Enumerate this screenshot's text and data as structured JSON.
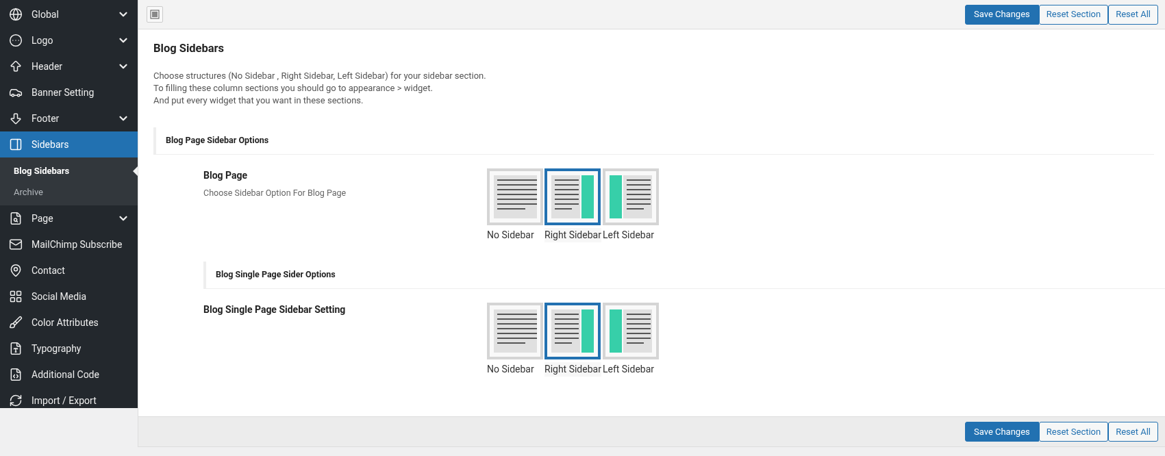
{
  "sidebar": {
    "items": [
      {
        "label": "Global",
        "expandable": true,
        "selected": false
      },
      {
        "label": "Logo",
        "expandable": true,
        "selected": false
      },
      {
        "label": "Header",
        "expandable": true,
        "selected": false
      },
      {
        "label": "Banner Setting",
        "expandable": false,
        "selected": false
      },
      {
        "label": "Footer",
        "expandable": true,
        "selected": false
      },
      {
        "label": "Sidebars",
        "expandable": false,
        "selected": true,
        "children": [
          {
            "label": "Blog Sidebars",
            "selected": true
          },
          {
            "label": "Archive",
            "selected": false
          }
        ]
      },
      {
        "label": "Page",
        "expandable": true,
        "selected": false
      },
      {
        "label": "MailChimp Subscribe",
        "expandable": false,
        "selected": false
      },
      {
        "label": "Contact",
        "expandable": false,
        "selected": false
      },
      {
        "label": "Social Media",
        "expandable": false,
        "selected": false
      },
      {
        "label": "Color Attributes",
        "expandable": false,
        "selected": false
      },
      {
        "label": "Typography",
        "expandable": false,
        "selected": false
      },
      {
        "label": "Additional Code",
        "expandable": false,
        "selected": false
      },
      {
        "label": "Import / Export",
        "expandable": false,
        "selected": false
      }
    ]
  },
  "toolbar_buttons": [
    "Save Changes",
    "Reset Section",
    "Reset All"
  ],
  "section": {
    "title": "Blog Sidebars",
    "description": [
      "Choose structures (No Sidebar , Right Sidebar, Left Sidebar) for your sidebar section.",
      "To filling these column sections you should go to appearance > widget.",
      "And put every widget that you want in these sections."
    ]
  },
  "groups": [
    {
      "heading": "Blog Page Sidebar Options",
      "indented": false,
      "field": {
        "label": "Blog Page",
        "hint": "Choose Sidebar Option For Blog Page",
        "options": [
          {
            "kind": "none",
            "label": "No Sidebar",
            "selected": false
          },
          {
            "kind": "right",
            "label": "Right Sidebar",
            "selected": true
          },
          {
            "kind": "left",
            "label": "Left Sidebar",
            "selected": false
          }
        ]
      }
    },
    {
      "heading": "Blog Single Page Sider Options",
      "indented": true,
      "field": {
        "label": "Blog Single Page Sidebar Setting",
        "options": [
          {
            "kind": "none",
            "label": "No Sidebar",
            "selected": false
          },
          {
            "kind": "right",
            "label": "Right Sidebar",
            "selected": true
          },
          {
            "kind": "left",
            "label": "Left Sidebar",
            "selected": false
          }
        ]
      }
    }
  ],
  "footer_buttons": [
    "Save Changes",
    "Reset Section",
    "Reset All"
  ]
}
